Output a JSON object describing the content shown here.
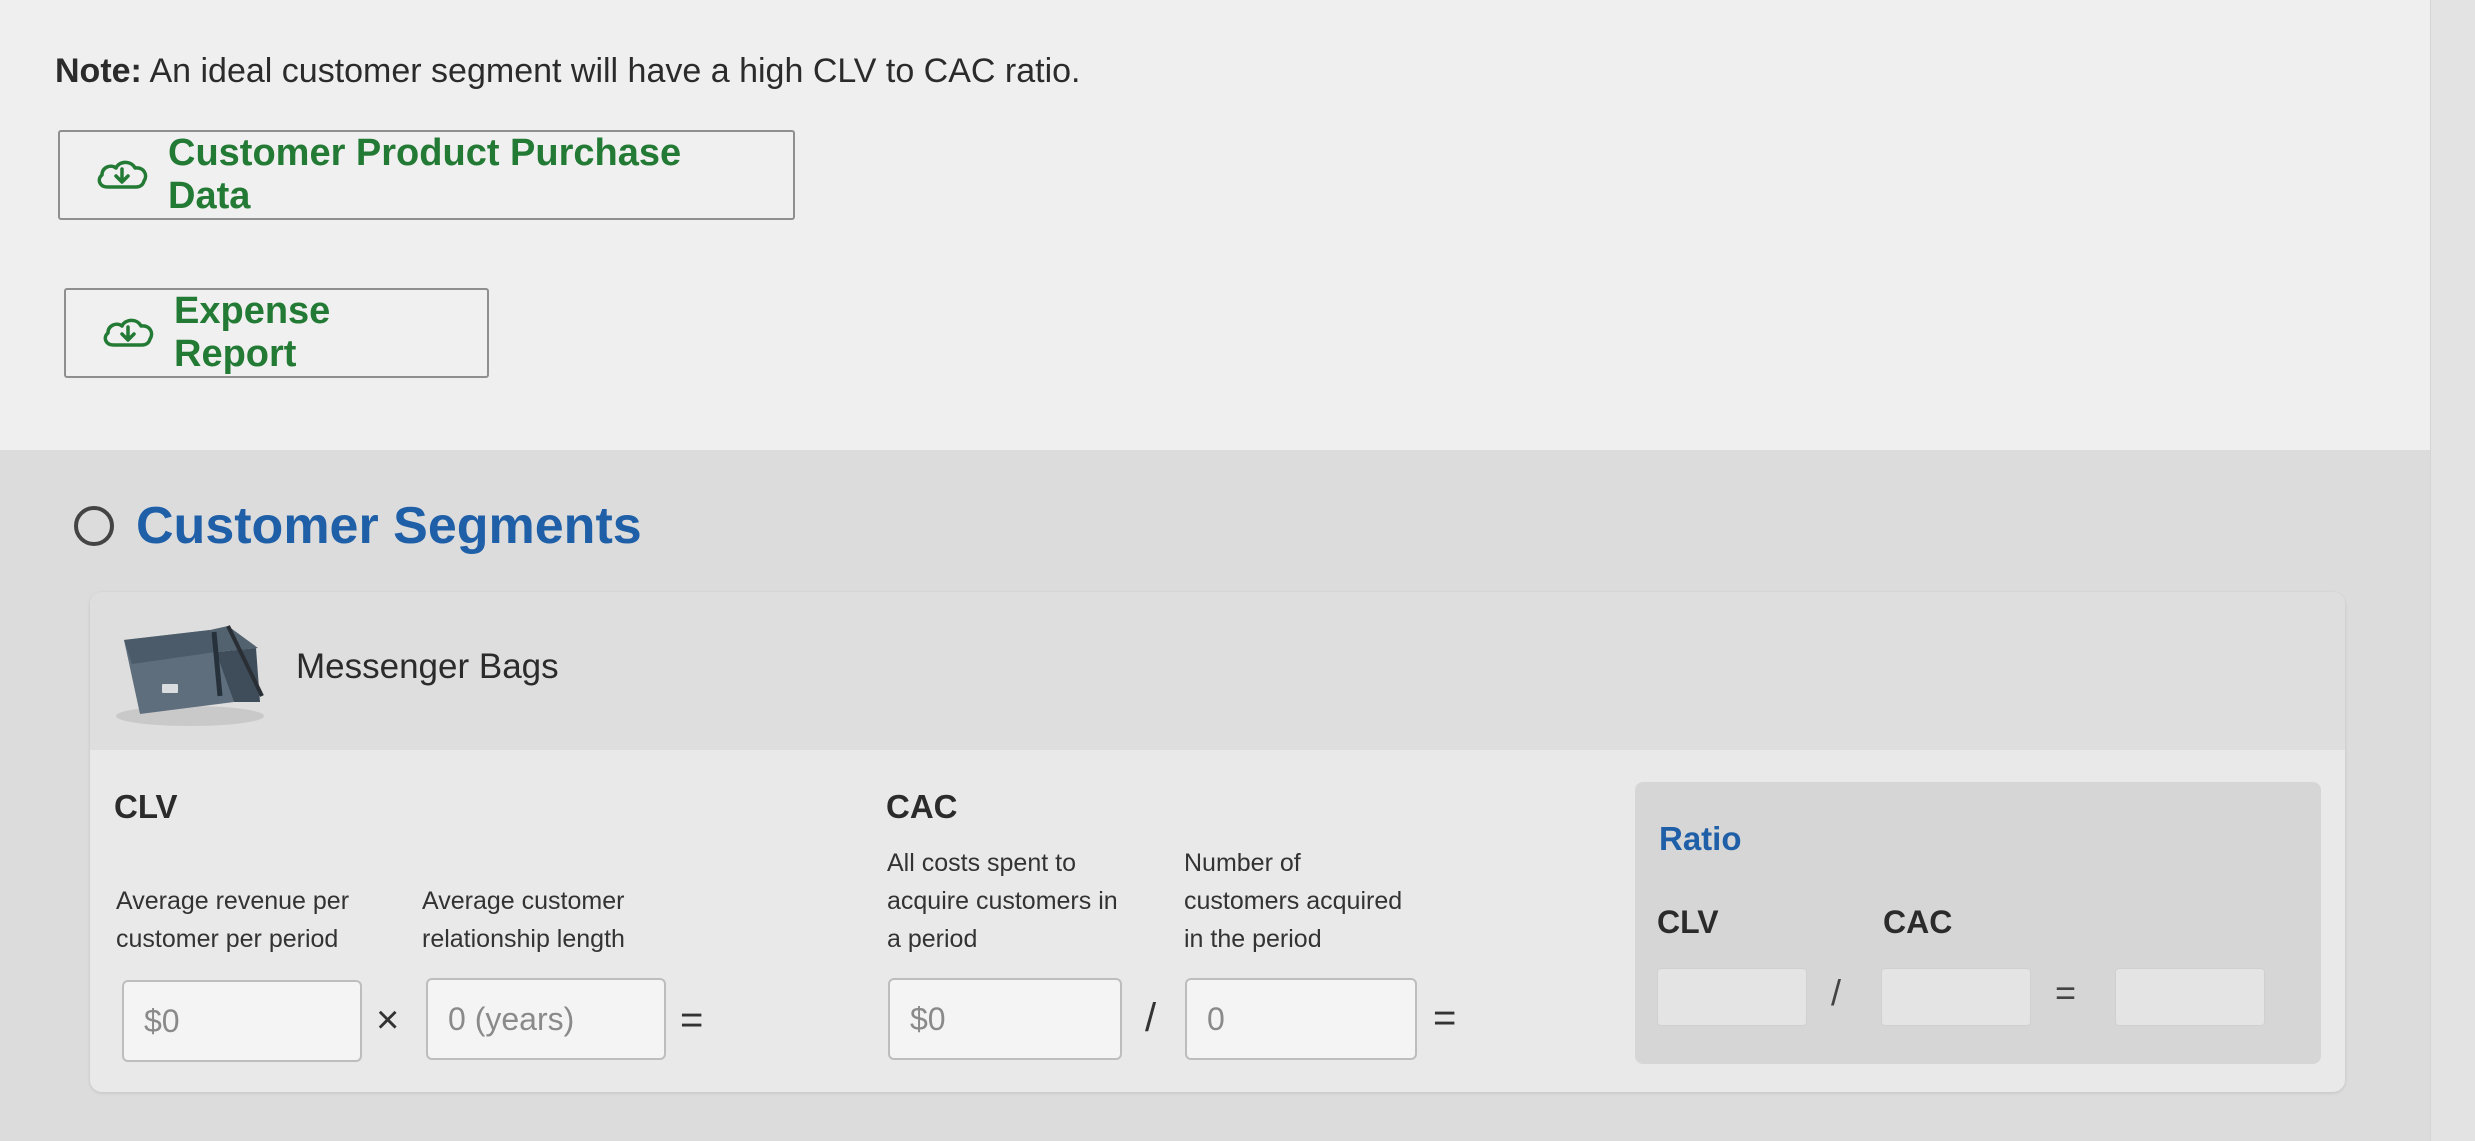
{
  "note": {
    "label": "Note:",
    "text": "An ideal customer segment will have a high CLV to CAC ratio."
  },
  "downloads": [
    {
      "label": "Customer Product Purchase Data",
      "icon": "cloud-download-icon"
    },
    {
      "label": "Expense Report",
      "icon": "cloud-download-icon"
    }
  ],
  "segments": {
    "title": "Customer Segments",
    "product": {
      "name": "Messenger Bags",
      "image": "messenger-bag-image"
    },
    "clv": {
      "heading": "CLV",
      "revenue_label_line1": "Average revenue per",
      "revenue_label_line2": "customer per period",
      "length_label_line1": "Average customer",
      "length_label_line2": "relationship length",
      "revenue_placeholder": "$0",
      "length_placeholder": "0 (years)",
      "multiply": "×",
      "equals": "="
    },
    "cac": {
      "heading": "CAC",
      "costs_label_line1": "All costs spent to",
      "costs_label_line2": "acquire customers in",
      "costs_label_line3": "a period",
      "customers_label_line1": "Number of",
      "customers_label_line2": "customers acquired",
      "customers_label_line3": "in the period",
      "costs_placeholder": "$0",
      "customers_placeholder": "0",
      "divide": "/",
      "equals": "="
    },
    "ratio": {
      "heading": "Ratio",
      "clv_label": "CLV",
      "cac_label": "CAC",
      "divide": "/",
      "equals": "="
    }
  },
  "colors": {
    "accent_green": "#237a34",
    "accent_blue": "#1f5fa8"
  }
}
